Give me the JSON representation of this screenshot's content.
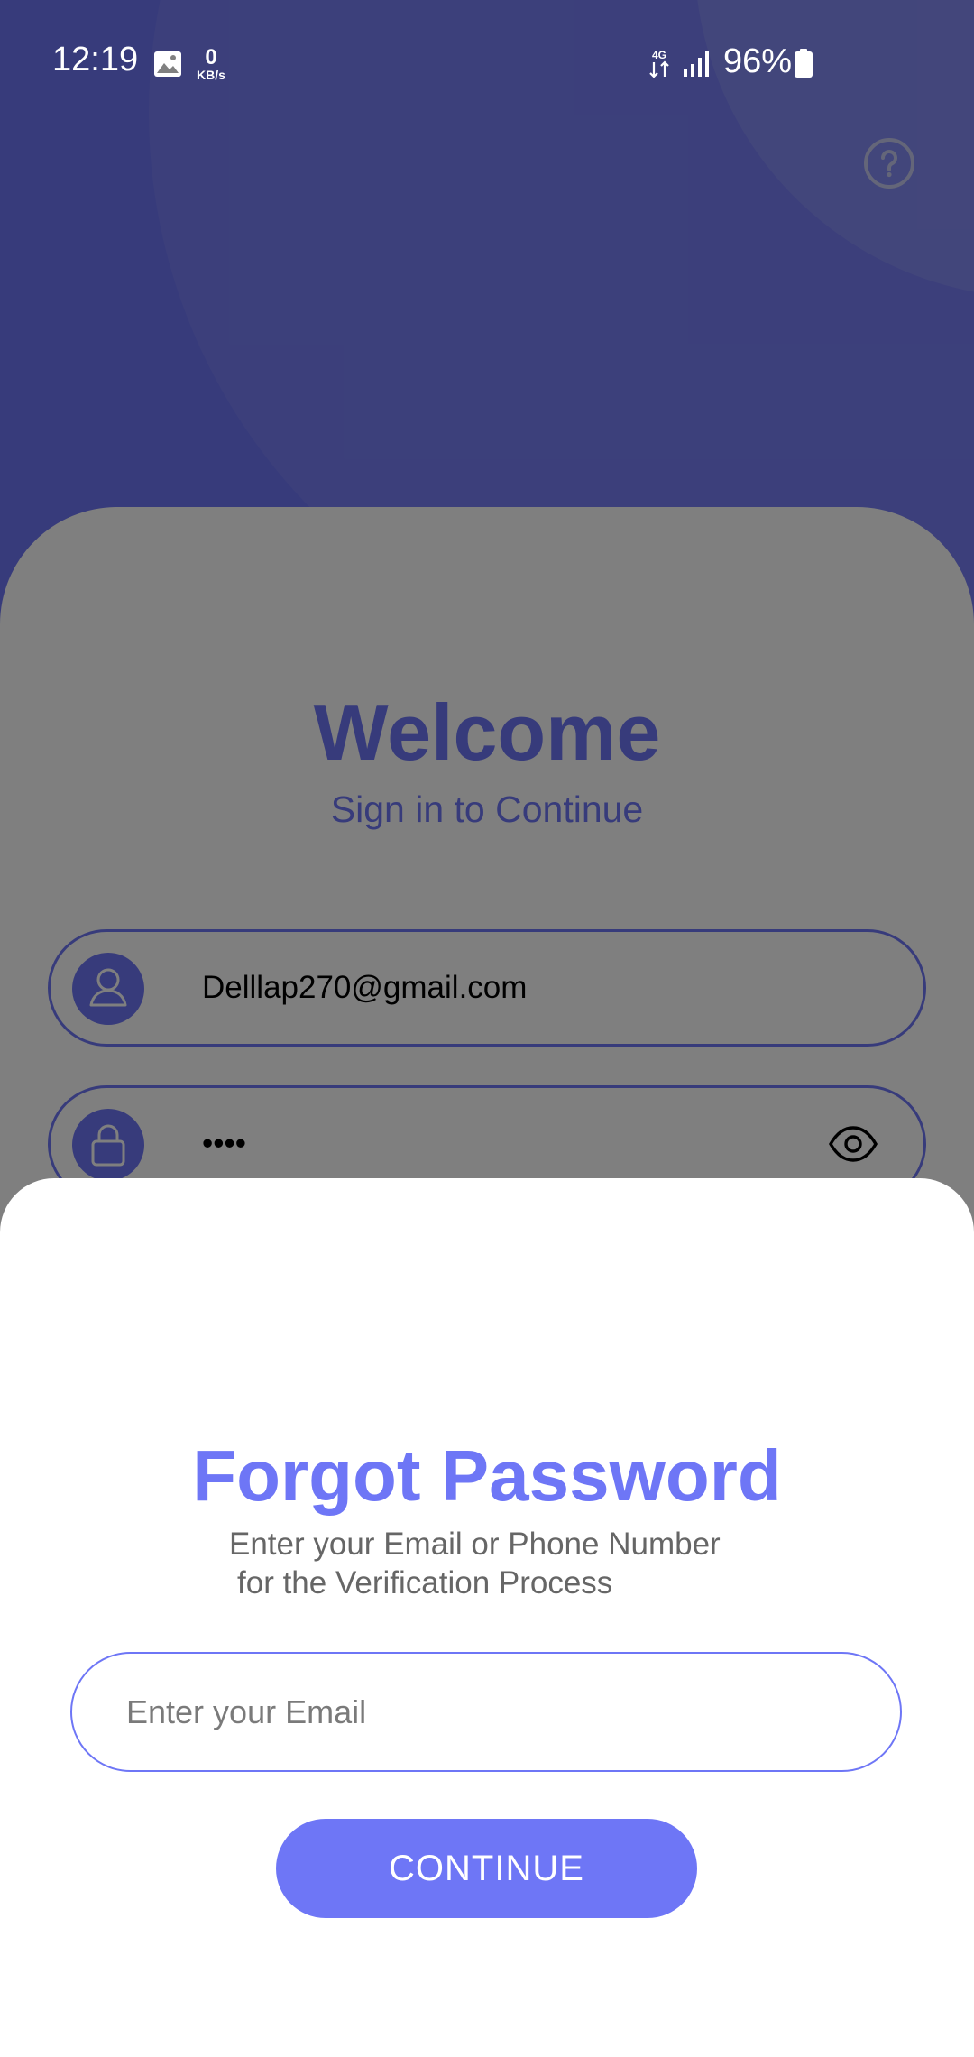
{
  "status_bar": {
    "time": "12:19",
    "speed_value": "0",
    "speed_unit": "KB/s",
    "battery_percent": "96%",
    "icons": [
      "gallery-icon",
      "network-4g-icon",
      "signal-icon",
      "battery-icon"
    ]
  },
  "login": {
    "title": "Welcome",
    "subtitle": "Sign in to Continue",
    "email_value": "Delllap270@gmail.com",
    "password_value": "••••",
    "icons": [
      "help-icon",
      "user-icon",
      "lock-icon",
      "eye-icon"
    ]
  },
  "forgot_sheet": {
    "title": "Forgot Password",
    "subtitle_line1": "Enter your Email or Phone Number",
    "subtitle_line2": "for the Verification Process",
    "email_placeholder": "Enter your Email",
    "button_label": "CONTINUE"
  },
  "colors": {
    "accent": "#6e76f6",
    "scrim": "rgba(0,0,0,0.5)",
    "sheet_background": "#ffffff"
  }
}
